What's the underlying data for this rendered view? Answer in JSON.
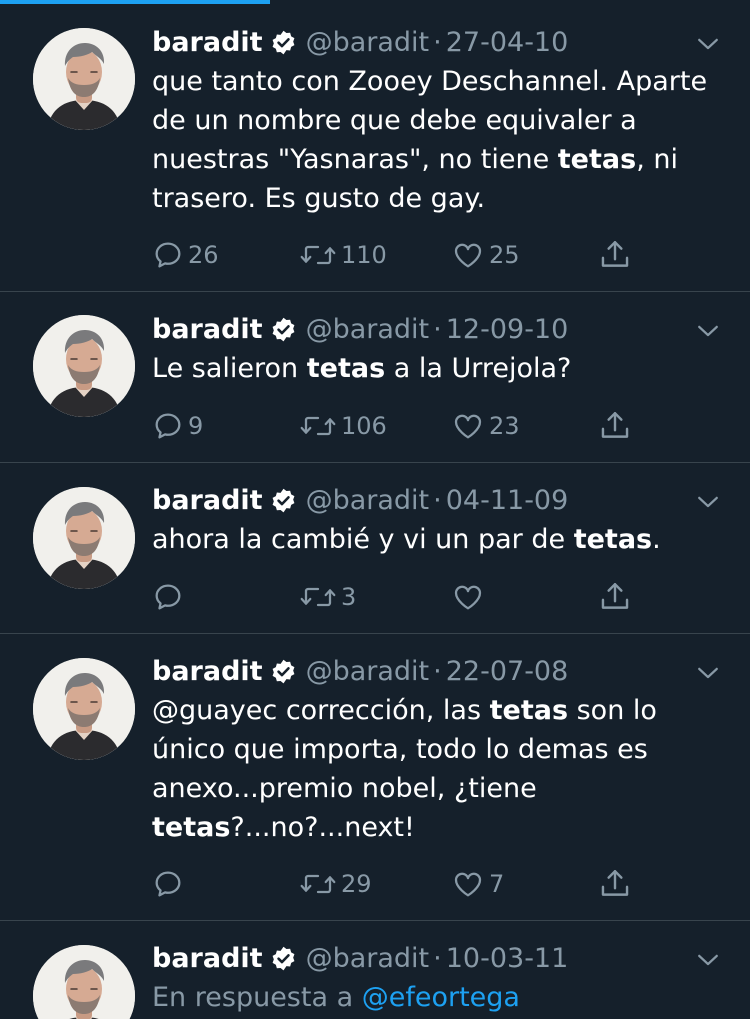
{
  "tweets": [
    {
      "name": "baradit",
      "handle": "@baradit",
      "date": "27-04-10",
      "text_parts": [
        {
          "t": "que tanto con Zooey Deschannel. Aparte de un nombre que debe equivaler a nuestras \"Yasnaras\", no tiene ",
          "b": false
        },
        {
          "t": "tetas",
          "b": true
        },
        {
          "t": ", ni trasero. Es gusto de gay.",
          "b": false
        }
      ],
      "replies": "26",
      "retweets": "110",
      "likes": "25"
    },
    {
      "name": "baradit",
      "handle": "@baradit",
      "date": "12-09-10",
      "text_parts": [
        {
          "t": "Le salieron ",
          "b": false
        },
        {
          "t": "tetas",
          "b": true
        },
        {
          "t": " a la Urrejola?",
          "b": false
        }
      ],
      "replies": "9",
      "retweets": "106",
      "likes": "23"
    },
    {
      "name": "baradit",
      "handle": "@baradit",
      "date": "04-11-09",
      "text_parts": [
        {
          "t": "ahora la cambié y vi un par de ",
          "b": false
        },
        {
          "t": "tetas",
          "b": true
        },
        {
          "t": ".",
          "b": false
        }
      ],
      "replies": "",
      "retweets": "3",
      "likes": ""
    },
    {
      "name": "baradit",
      "handle": "@baradit",
      "date": "22-07-08",
      "text_parts": [
        {
          "t": "@guayec corrección, las ",
          "b": false
        },
        {
          "t": "tetas",
          "b": true
        },
        {
          "t": " son lo único que importa, todo lo demas es anexo...premio nobel, ¿tiene ",
          "b": false
        },
        {
          "t": "tetas",
          "b": true
        },
        {
          "t": "?...no?...next!",
          "b": false
        }
      ],
      "replies": "",
      "retweets": "29",
      "likes": "7"
    },
    {
      "name": "baradit",
      "handle": "@baradit",
      "date": "10-03-11",
      "reply_prefix": "En respuesta a ",
      "reply_to": "@efeortega"
    }
  ],
  "separator": "·",
  "icons": {
    "verified": "verified-badge-icon",
    "menu": "chevron-down-icon",
    "reply": "reply-icon",
    "retweet": "retweet-icon",
    "like": "heart-icon",
    "share": "share-icon"
  },
  "colors": {
    "background": "#15202b",
    "text": "#ffffff",
    "muted": "#8899a6",
    "accent": "#1da1f2",
    "divider": "#38444d"
  },
  "progress_fraction": 0.36
}
